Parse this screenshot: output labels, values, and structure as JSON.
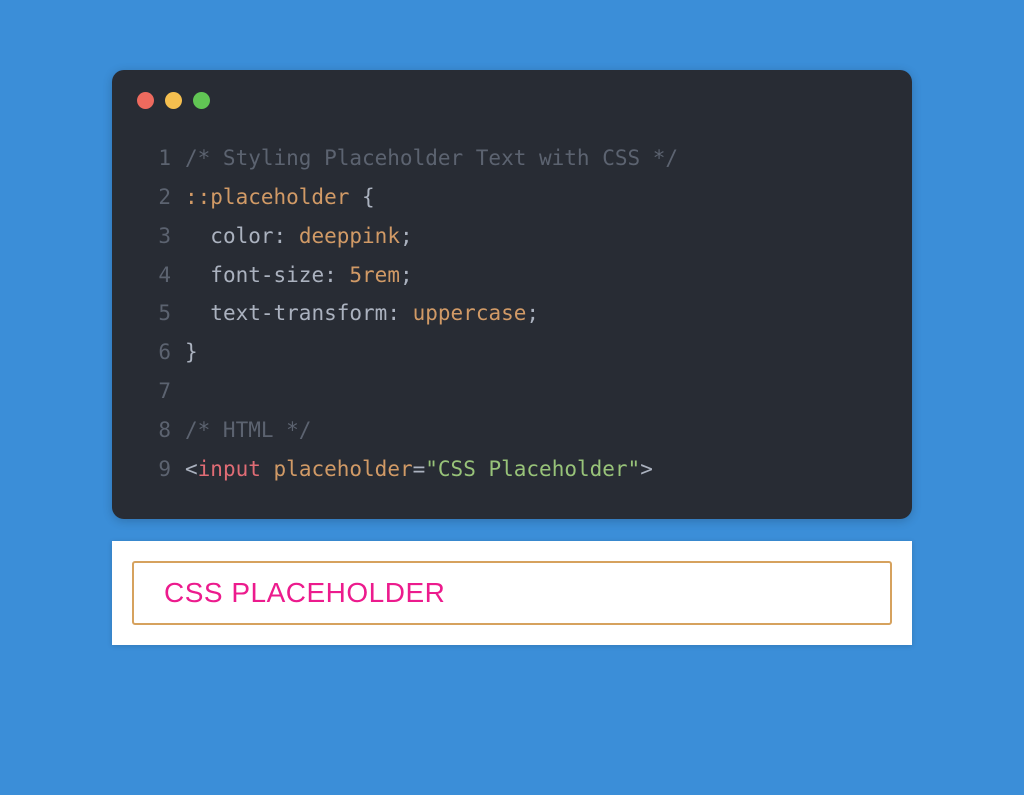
{
  "code": {
    "lines": [
      {
        "n": "1",
        "tokens": [
          {
            "cls": "c-comment",
            "t": "/* Styling Placeholder Text with CSS */"
          }
        ]
      },
      {
        "n": "2",
        "tokens": [
          {
            "cls": "c-selector",
            "t": "::placeholder"
          },
          {
            "cls": "c-plain",
            "t": " {"
          }
        ]
      },
      {
        "n": "3",
        "tokens": [
          {
            "cls": "c-plain",
            "t": "  "
          },
          {
            "cls": "c-prop",
            "t": "color"
          },
          {
            "cls": "c-punct",
            "t": ": "
          },
          {
            "cls": "c-value",
            "t": "deeppink"
          },
          {
            "cls": "c-punct",
            "t": ";"
          }
        ]
      },
      {
        "n": "4",
        "tokens": [
          {
            "cls": "c-plain",
            "t": "  "
          },
          {
            "cls": "c-prop",
            "t": "font-size"
          },
          {
            "cls": "c-punct",
            "t": ": "
          },
          {
            "cls": "c-num",
            "t": "5rem"
          },
          {
            "cls": "c-punct",
            "t": ";"
          }
        ]
      },
      {
        "n": "5",
        "tokens": [
          {
            "cls": "c-plain",
            "t": "  "
          },
          {
            "cls": "c-prop",
            "t": "text-transform"
          },
          {
            "cls": "c-punct",
            "t": ": "
          },
          {
            "cls": "c-value",
            "t": "uppercase"
          },
          {
            "cls": "c-punct",
            "t": ";"
          }
        ]
      },
      {
        "n": "6",
        "tokens": [
          {
            "cls": "c-plain",
            "t": "}"
          }
        ]
      },
      {
        "n": "7",
        "tokens": [
          {
            "cls": "c-plain",
            "t": ""
          }
        ]
      },
      {
        "n": "8",
        "tokens": [
          {
            "cls": "c-comment",
            "t": "/* HTML */"
          }
        ]
      },
      {
        "n": "9",
        "tokens": [
          {
            "cls": "c-plain",
            "t": "<"
          },
          {
            "cls": "c-tag",
            "t": "input"
          },
          {
            "cls": "c-plain",
            "t": " "
          },
          {
            "cls": "c-attr",
            "t": "placeholder"
          },
          {
            "cls": "c-plain",
            "t": "="
          },
          {
            "cls": "c-string",
            "t": "\"CSS Placeholder\""
          },
          {
            "cls": "c-plain",
            "t": ">"
          }
        ]
      }
    ]
  },
  "preview": {
    "placeholder": "CSS Placeholder"
  },
  "colors": {
    "background": "#3b8ed8",
    "codeBg": "#282c34",
    "placeholderColor": "#ec1b8d",
    "inputBorder": "#d6a25e"
  }
}
